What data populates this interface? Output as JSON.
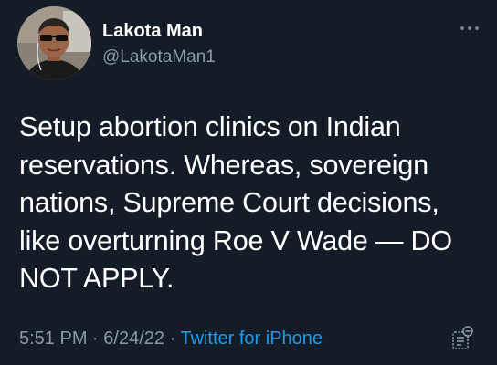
{
  "user": {
    "display_name": "Lakota Man",
    "handle": "@LakotaMan1",
    "avatar_icon": "profile-photo"
  },
  "tweet": {
    "text": "Setup abortion clinics on Indian\nreservations. Whereas, sovereign\nnations, Supreme Court decisions,\nlike overturning Roe V Wade — DO\nNOT APPLY.",
    "time": "5:51 PM",
    "separator_1": " · ",
    "date": "6/24/22",
    "separator_2": " · ",
    "source": "Twitter for iPhone"
  },
  "icons": {
    "more": "more-icon",
    "view_activity": "view-activity-icon"
  },
  "colors": {
    "background": "#141d27",
    "primary_text": "#ffffff",
    "secondary_text": "#8899a6",
    "link": "#1d9bf0"
  }
}
